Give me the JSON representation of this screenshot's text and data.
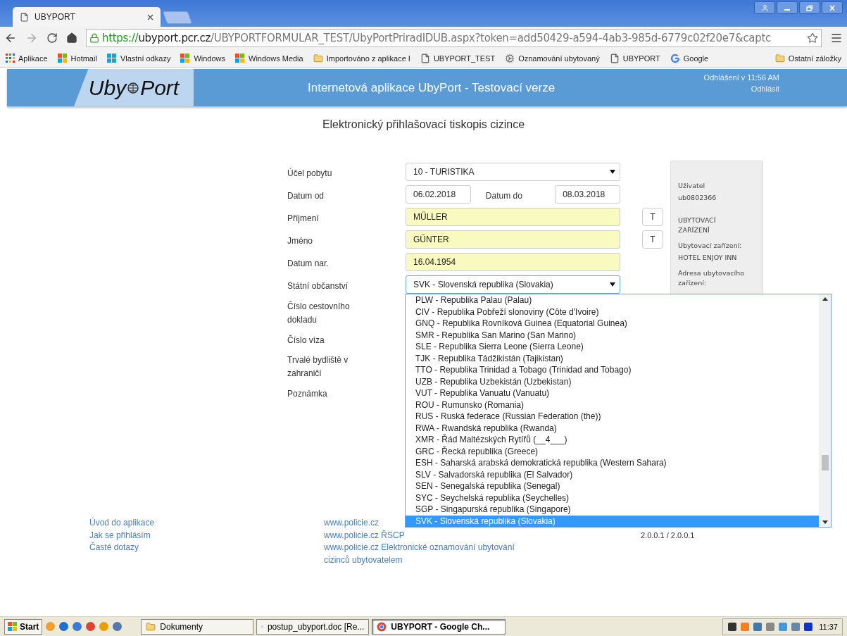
{
  "browser": {
    "tab_title": "UBYPORT",
    "url_scheme": "https://",
    "url_host": "ubyport.pcr.cz",
    "url_path": "/UBYPORTFORMULAR_TEST/UbyPortPriradIDUB.aspx?token=add50429-a594-4ab3-985d-6779c02f20e7&captc",
    "bookmarks": [
      {
        "label": "Aplikace",
        "kind": "apps"
      },
      {
        "label": "Hotmail",
        "kind": "windows"
      },
      {
        "label": "Vlastní odkazy",
        "kind": "windows_flat"
      },
      {
        "label": "Windows",
        "kind": "windows"
      },
      {
        "label": "Windows Media",
        "kind": "windows"
      },
      {
        "label": "Importováno z aplikace I",
        "kind": "folder"
      },
      {
        "label": "UBYPORT_TEST",
        "kind": "page"
      },
      {
        "label": "Oznamování ubytovaný",
        "kind": "seal"
      },
      {
        "label": "UBYPORT",
        "kind": "page"
      },
      {
        "label": "Google",
        "kind": "google"
      }
    ],
    "other_bookmarks": "Ostatní záložky"
  },
  "header": {
    "logo_left": "Uby",
    "logo_right": "Port",
    "app_title": "Internetová aplikace UbyPort - Testovací verze",
    "logout_info": "Odhlášení v 11:56 AM",
    "logout_link": "Odhlásit"
  },
  "page_title": "Elektronický přihlašovací tiskopis cizince",
  "form": {
    "fields": [
      {
        "kind": "select",
        "label": "Účel pobytu",
        "value": "10 - TURISTIKA",
        "highlighted": false,
        "focused": false
      },
      {
        "kind": "date_range",
        "label": "Datum od",
        "value": "06.02.2018",
        "label_2": "Datum do",
        "value_2": "08.03.2018"
      },
      {
        "kind": "text",
        "label": "Příjmení",
        "value": "MŰLLER",
        "highlighted": true,
        "button": "T"
      },
      {
        "kind": "text",
        "label": "Jméno",
        "value": "GŰNTER",
        "highlighted": true,
        "button": "T"
      },
      {
        "kind": "text",
        "label": "Datum nar.",
        "value": "16.04.1954",
        "highlighted": true
      },
      {
        "kind": "select",
        "label": "Státní občanství",
        "value": "SVK - Slovenská republika (Slovakia)",
        "highlighted": false,
        "focused": true
      },
      {
        "kind": "covered",
        "label": "Číslo cestovního dokladu"
      },
      {
        "kind": "covered",
        "label": "Číslo víza"
      },
      {
        "kind": "covered",
        "label": "Trvalé bydliště v zahraničí"
      },
      {
        "kind": "covered",
        "label": "Poznámka"
      }
    ],
    "dropdown_options": [
      {
        "label": "PLW - Republika Palau (Palau)",
        "selected": false
      },
      {
        "label": "CIV - Republika Pobřeží slonoviny (Côte d'Ivoire)",
        "selected": false
      },
      {
        "label": "GNQ - Republika Rovníková Guinea (Equatorial Guinea)",
        "selected": false
      },
      {
        "label": "SMR - Republika San Marino (San Marino)",
        "selected": false
      },
      {
        "label": "SLE - Republika Sierra Leone (Sierra Leone)",
        "selected": false
      },
      {
        "label": "TJK - Republika Tádžikistán (Tajikistan)",
        "selected": false
      },
      {
        "label": "TTO - Republika Trinidad a Tobago (Trinidad and Tobago)",
        "selected": false
      },
      {
        "label": "UZB - Republika Uzbekistán (Uzbekistan)",
        "selected": false
      },
      {
        "label": "VUT - Republika Vanuatu (Vanuatu)",
        "selected": false
      },
      {
        "label": "ROU - Rumunsko (Romania)",
        "selected": false
      },
      {
        "label": "RUS - Ruská federace (Russian Federation (the))",
        "selected": false
      },
      {
        "label": "RWA - Rwandská republika (Rwanda)",
        "selected": false
      },
      {
        "label": "XMR - Řád Maltézských Rytířů (__4___)",
        "selected": false
      },
      {
        "label": "GRC - Řecká republika (Greece)",
        "selected": false
      },
      {
        "label": "ESH - Saharská arabská demokratická republika (Western Sahara)",
        "selected": false
      },
      {
        "label": "SLV - Salvadorská republika (El Salvador)",
        "selected": false
      },
      {
        "label": "SEN - Senegalská republika (Senegal)",
        "selected": false
      },
      {
        "label": "SYC - Seychelská republika (Seychelles)",
        "selected": false
      },
      {
        "label": "SGP - Singapurská republika (Singapore)",
        "selected": false
      },
      {
        "label": "SVK - Slovenská republika (Slovakia)",
        "selected": true
      }
    ]
  },
  "sidebar": {
    "items": [
      {
        "kind": "label",
        "text": "Uživatel"
      },
      {
        "kind": "value",
        "text": "ub0802366"
      },
      {
        "kind": "heading",
        "text": "UBYTOVACÍ ZAŘÍZENÍ"
      },
      {
        "kind": "label",
        "text": "Ubytovací zařízení:"
      },
      {
        "kind": "value",
        "text": "HOTEL ENJOY INN"
      },
      {
        "kind": "label",
        "text": "Adresa ubytovacího zařízení:"
      }
    ]
  },
  "footer": {
    "column_1": [
      "Úvod do aplikace",
      "Jak se přihlásím",
      "Časté dotazy"
    ],
    "column_2": [
      "www.policie.cz",
      "www.policie.cz ŘSCP",
      "www.policie.cz Elektronické oznamování ubytování cizinců ubytovatelem"
    ],
    "version": "2.0.0.1 / 2.0.0.1"
  },
  "taskbar": {
    "start": "Start",
    "tasks": [
      {
        "label": "Dokumenty",
        "kind": "folder",
        "selected": false
      },
      {
        "label": "postup_ubyport.doc [Re...",
        "kind": "document",
        "selected": false
      },
      {
        "label": "UBYPORT - Google Ch...",
        "kind": "browser",
        "selected": true
      }
    ],
    "clock": "11:37"
  }
}
